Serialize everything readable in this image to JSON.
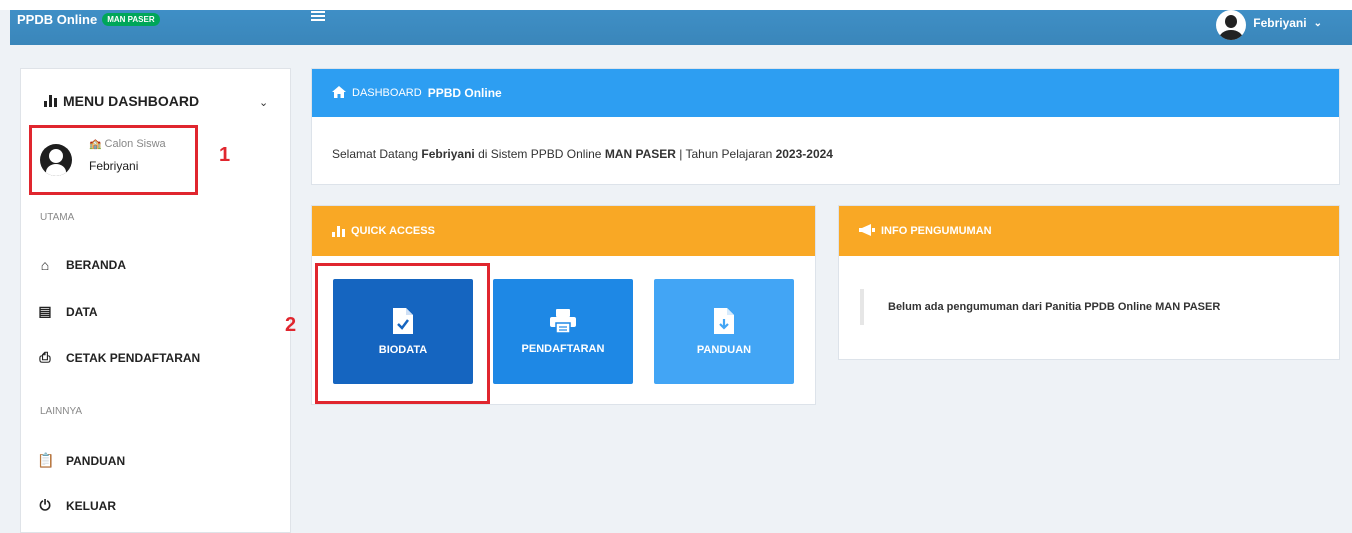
{
  "navbar": {
    "brand_title": "PPDB Online",
    "brand_badge": "MAN PASER",
    "user_name": "Febriyani",
    "bg_color": "#3c8dbc"
  },
  "sidebar": {
    "menu_title": "MENU DASHBOARD",
    "profile": {
      "role": "Calon Siswa",
      "name": "Febriyani"
    },
    "sections": [
      {
        "label": "UTAMA"
      },
      {
        "label": "LAINNYA"
      }
    ],
    "items": [
      {
        "label": "BERANDA",
        "icon": "home-icon"
      },
      {
        "label": "DATA",
        "icon": "list-icon"
      },
      {
        "label": "CETAK PENDAFTARAN",
        "icon": "print-icon"
      },
      {
        "label": "PANDUAN",
        "icon": "clipboard-icon"
      },
      {
        "label": "KELUAR",
        "icon": "power-icon"
      }
    ]
  },
  "annotations": {
    "one": "1",
    "two": "2",
    "color": "#e0262e"
  },
  "dashboard": {
    "title_prefix": "DASHBOARD",
    "title_bold": "PPBD Online",
    "welcome": {
      "part1": "Selamat Datang ",
      "name": "Febriyani",
      "part2": " di Sistem PPBD Online ",
      "school": "MAN PASER",
      "part3": " | Tahun Pelajaran ",
      "year": "2023-2024"
    },
    "header_color": "#2d9ef2"
  },
  "quick_access": {
    "title": "QUICK ACCESS",
    "header_color": "#f9a825",
    "tiles": [
      {
        "label": "BIODATA",
        "icon": "file-check-icon",
        "color": "#1565c0"
      },
      {
        "label": "PENDAFTARAN",
        "icon": "printer-icon",
        "color": "#1e88e5"
      },
      {
        "label": "PANDUAN",
        "icon": "file-download-icon",
        "color": "#42a5f5"
      }
    ]
  },
  "info": {
    "title": "INFO PENGUMUMAN",
    "message": "Belum ada pengumuman dari Panitia PPDB Online MAN PASER"
  }
}
